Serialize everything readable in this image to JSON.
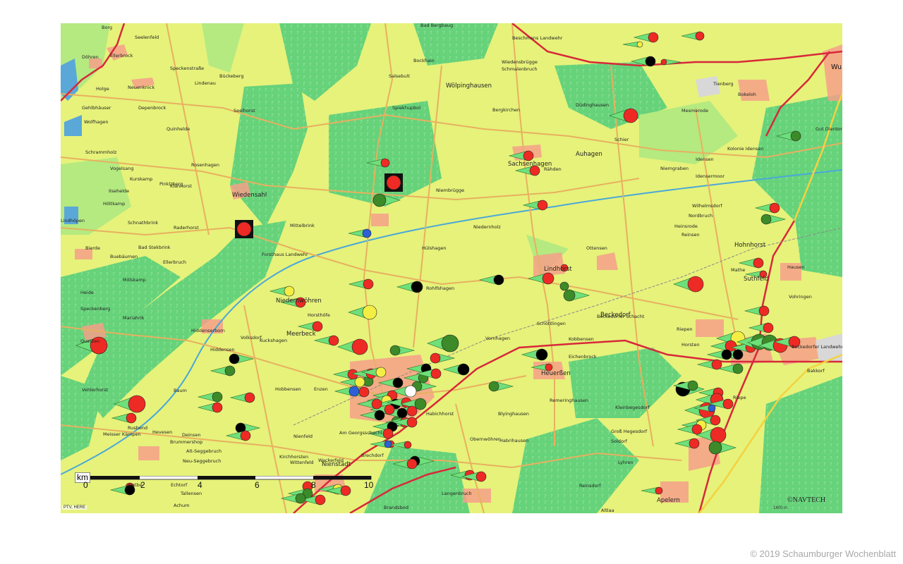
{
  "map": {
    "scale": {
      "unit": "km",
      "ticks": [
        "0",
        "2",
        "4",
        "6",
        "8",
        "10"
      ]
    },
    "attribution": "©NAVTECH",
    "scalebar_right_label": "1400 m",
    "data_credit": "PTV, HERE",
    "places": [
      {
        "name": "Borg"
      },
      {
        "name": "Seelenfeld"
      },
      {
        "name": "Döhren"
      },
      {
        "name": "Ellerbrock"
      },
      {
        "name": "Speckenstraße"
      },
      {
        "name": "Bückeberg"
      },
      {
        "name": "Lindenau"
      },
      {
        "name": "Neuenknick"
      },
      {
        "name": "Holge"
      },
      {
        "name": "Gehlbhäuser"
      },
      {
        "name": "Depenbrock"
      },
      {
        "name": "Wolfhagen"
      },
      {
        "name": "Quinhelde"
      },
      {
        "name": "Seelhorst"
      },
      {
        "name": "Schrammholz"
      },
      {
        "name": "Vogelsang"
      },
      {
        "name": "Rosenhagen"
      },
      {
        "name": "Kurskamp"
      },
      {
        "name": "Pinklzberg"
      },
      {
        "name": "Klanhorst"
      },
      {
        "name": "Ilsehelde"
      },
      {
        "name": "Höltkamp"
      },
      {
        "name": "Wiedensahl"
      },
      {
        "name": "Schnathbrink"
      },
      {
        "name": "Raderhorst"
      },
      {
        "name": "Lindhöpen"
      },
      {
        "name": "Bierde"
      },
      {
        "name": "Bad Stekbrink"
      },
      {
        "name": "Buebäumen"
      },
      {
        "name": "Ellerbruch"
      },
      {
        "name": "Mölskamp"
      },
      {
        "name": "Heide"
      },
      {
        "name": "Speckenberg"
      },
      {
        "name": "Mariahrik"
      },
      {
        "name": "Quetzen"
      },
      {
        "name": "Bad Bergbaug"
      },
      {
        "name": "Beschmens Landwehr"
      },
      {
        "name": "Bockhain"
      },
      {
        "name": "Salsebult"
      },
      {
        "name": "Wiedensbrügge"
      },
      {
        "name": "Schmalenbruch"
      },
      {
        "name": "Wölpinghausen"
      },
      {
        "name": "Bergkirchen"
      },
      {
        "name": "Düdinghausen"
      },
      {
        "name": "Spiekhupbol"
      },
      {
        "name": "Sachsenhagen"
      },
      {
        "name": "Auhagen"
      },
      {
        "name": "Rähden"
      },
      {
        "name": "Niemgraben"
      },
      {
        "name": "Idensen"
      },
      {
        "name": "Idensermoor"
      },
      {
        "name": "Kolonie Idensen"
      },
      {
        "name": "Mesmerode"
      },
      {
        "name": "Bokeloh"
      },
      {
        "name": "Tienberg"
      },
      {
        "name": "Gut Dierdorf"
      },
      {
        "name": "Schier"
      },
      {
        "name": "Wu"
      },
      {
        "name": "Niembrügge"
      },
      {
        "name": "Mittelbrink"
      },
      {
        "name": "Forsthaus Landwehr"
      },
      {
        "name": "Niedernholz"
      },
      {
        "name": "Hülshagen"
      },
      {
        "name": "Lindhorst"
      },
      {
        "name": "Ottensen"
      },
      {
        "name": "Wilhelmsdorf"
      },
      {
        "name": "Nordbruch"
      },
      {
        "name": "Reinsen"
      },
      {
        "name": "Heinsrode"
      },
      {
        "name": "Hohnhorst"
      },
      {
        "name": "Mathe"
      },
      {
        "name": "Suthfeld"
      },
      {
        "name": "Rohlfshagen"
      },
      {
        "name": "Vohringen"
      },
      {
        "name": "Hausen"
      },
      {
        "name": "Niedernwöhren"
      },
      {
        "name": "Horsthöfe"
      },
      {
        "name": "Meerbeck"
      },
      {
        "name": "Hiddenserborn"
      },
      {
        "name": "Volksdorf"
      },
      {
        "name": "Kuckshagen"
      },
      {
        "name": "Hiddensen"
      },
      {
        "name": "Beckedorf"
      },
      {
        "name": "Beckedorfer Schacht"
      },
      {
        "name": "Schöttlingen"
      },
      {
        "name": "Kobbensen"
      },
      {
        "name": "Eichenbrock"
      },
      {
        "name": "Horsten"
      },
      {
        "name": "Riepen"
      },
      {
        "name": "Heuerßen"
      },
      {
        "name": "Vornhagen"
      },
      {
        "name": "Remeringhausen"
      },
      {
        "name": "Riepe"
      },
      {
        "name": "Kleinbegesdorf"
      },
      {
        "name": "Groß Hegesdorf"
      },
      {
        "name": "Soldorf"
      },
      {
        "name": "Lyhren"
      },
      {
        "name": "Reinsdorf"
      },
      {
        "name": "Apelern"
      },
      {
        "name": "Altlaa"
      },
      {
        "name": "Beckedorfer Landwehr"
      },
      {
        "name": "Bakkorf"
      },
      {
        "name": "Vehlerhorst"
      },
      {
        "name": "Baum"
      },
      {
        "name": "Hobbensen"
      },
      {
        "name": "Enzen"
      },
      {
        "name": "Habichhorst"
      },
      {
        "name": "Blyinghausen"
      },
      {
        "name": "Obernwöhren"
      },
      {
        "name": "Habrihausen"
      },
      {
        "name": "Rusbend"
      },
      {
        "name": "Meisser Kämpen"
      },
      {
        "name": "Hevesen"
      },
      {
        "name": "Brummershop"
      },
      {
        "name": "Alt-Seggebruch"
      },
      {
        "name": "Neu-Seggebruch"
      },
      {
        "name": "Deinsen"
      },
      {
        "name": "Nienfeld"
      },
      {
        "name": "Wackerfeld"
      },
      {
        "name": "Am Georgsschacht"
      },
      {
        "name": "Kirchhorsten"
      },
      {
        "name": "Wittenfeld"
      },
      {
        "name": "Brechdorf"
      },
      {
        "name": "Nienstädt"
      },
      {
        "name": "Echtorf"
      },
      {
        "name": "Wetbe"
      },
      {
        "name": "Tallensen"
      },
      {
        "name": "Achum"
      },
      {
        "name": "Langenbruch"
      },
      {
        "name": "Brandsbod"
      }
    ]
  },
  "footer": {
    "copyright": "© 2019 Schaumburger Wochenblatt"
  },
  "colors": {
    "map_background": "#e6f27a",
    "forest": "#66d27a",
    "settlement": "#f6a08a",
    "main_road": "#d8283a",
    "secondary_road": "#e8b060",
    "river": "#4aa8d8",
    "marker_red": "#ee2a24",
    "marker_black": "#000000",
    "marker_yellow": "#f4ee44",
    "marker_green": "#3c8a28",
    "marker_blue": "#2e5fd6",
    "marker_purple": "#6a2a9a",
    "marker_arrow_green": "#6ee07a"
  },
  "legend_icons": [
    "red-circle-marker",
    "black-circle-marker",
    "yellow-circle-marker",
    "green-circle-marker",
    "blue-circle-marker",
    "white-circle-marker",
    "red-square-marker",
    "direction-arrow-icon"
  ]
}
